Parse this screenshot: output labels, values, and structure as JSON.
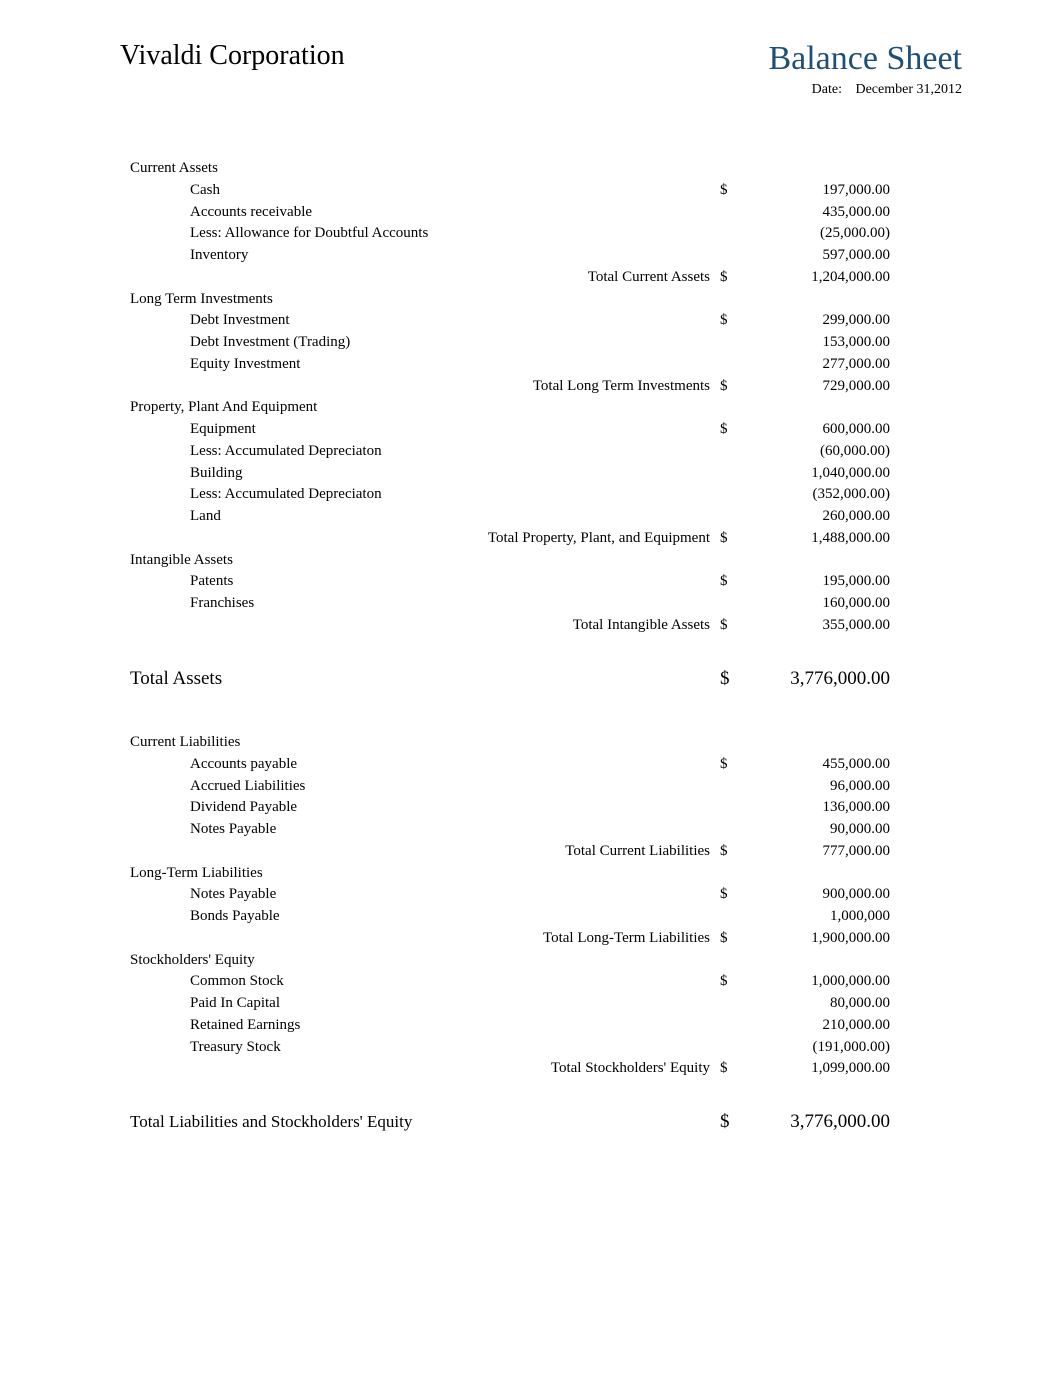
{
  "header": {
    "company": "Vivaldi Corporation",
    "title": "Balance Sheet",
    "date_label": "Date:",
    "date_value": "December 31,2012"
  },
  "assets": {
    "current": {
      "heading": "Current Assets",
      "items": [
        {
          "label": "Cash",
          "dollar": "$",
          "value": "197,000.00"
        },
        {
          "label": "Accounts receivable",
          "dollar": "",
          "value": "435,000.00"
        },
        {
          "label": "Less: Allowance for Doubtful Accounts",
          "dollar": "",
          "value": "(25,000.00)"
        },
        {
          "label": "Inventory",
          "dollar": "",
          "value": "597,000.00"
        }
      ],
      "total_label": "Total Current Assets",
      "total_dollar": "$",
      "total_value": "1,204,000.00"
    },
    "long_term": {
      "heading": "Long Term Investments",
      "items": [
        {
          "label": "Debt Investment",
          "dollar": "$",
          "value": "299,000.00"
        },
        {
          "label": "Debt Investment (Trading)",
          "dollar": "",
          "value": "153,000.00"
        },
        {
          "label": "Equity Investment",
          "dollar": "",
          "value": "277,000.00"
        }
      ],
      "total_label": "Total Long Term Investments",
      "total_dollar": "$",
      "total_value": "729,000.00"
    },
    "ppe": {
      "heading": "Property, Plant And Equipment",
      "items": [
        {
          "label": "Equipment",
          "dollar": "$",
          "value": "600,000.00"
        },
        {
          "label": "Less: Accumulated Depreciaton",
          "dollar": "",
          "value": "(60,000.00)"
        },
        {
          "label": "Building",
          "dollar": "",
          "value": "1,040,000.00"
        },
        {
          "label": "Less: Accumulated Depreciaton",
          "dollar": "",
          "value": "(352,000.00)"
        },
        {
          "label": "Land",
          "dollar": "",
          "value": "260,000.00"
        }
      ],
      "total_label": "Total Property, Plant, and Equipment",
      "total_dollar": "$",
      "total_value": "1,488,000.00"
    },
    "intangible": {
      "heading": "Intangible Assets",
      "items": [
        {
          "label": "Patents",
          "dollar": "$",
          "value": "195,000.00"
        },
        {
          "label": "Franchises",
          "dollar": "",
          "value": "160,000.00"
        }
      ],
      "total_label": "Total Intangible Assets",
      "total_dollar": "$",
      "total_value": "355,000.00"
    },
    "grand_total": {
      "label": "Total Assets",
      "dollar": "$",
      "value": "3,776,000.00"
    }
  },
  "liabilities": {
    "current": {
      "heading": "Current Liabilities",
      "items": [
        {
          "label": "Accounts payable",
          "dollar": "$",
          "value": "455,000.00"
        },
        {
          "label": "Accrued Liabilities",
          "dollar": "",
          "value": "96,000.00"
        },
        {
          "label": "Dividend Payable",
          "dollar": "",
          "value": "136,000.00"
        },
        {
          "label": "Notes Payable",
          "dollar": "",
          "value": "90,000.00"
        }
      ],
      "total_label": "Total Current Liabilities",
      "total_dollar": "$",
      "total_value": "777,000.00"
    },
    "long_term": {
      "heading": "Long-Term Liabilities",
      "items": [
        {
          "label": "Notes Payable",
          "dollar": "$",
          "value": "900,000.00"
        },
        {
          "label": "Bonds Payable",
          "dollar": "",
          "value": "1,000,000"
        }
      ],
      "total_label": "Total Long-Term Liabilities",
      "total_dollar": "$",
      "total_value": "1,900,000.00"
    },
    "equity": {
      "heading": "Stockholders' Equity",
      "items": [
        {
          "label": "Common Stock",
          "dollar": "$",
          "value": "1,000,000.00"
        },
        {
          "label": "Paid In Capital",
          "dollar": "",
          "value": "80,000.00"
        },
        {
          "label": "Retained Earnings",
          "dollar": "",
          "value": "210,000.00"
        },
        {
          "label": "Treasury Stock",
          "dollar": "",
          "value": "(191,000.00)"
        }
      ],
      "total_label": "Total Stockholders' Equity",
      "total_dollar": "$",
      "total_value": "1,099,000.00"
    },
    "grand_total": {
      "label": "Total Liabilities and Stockholders' Equity",
      "dollar": "$",
      "value": "3,776,000.00"
    }
  }
}
